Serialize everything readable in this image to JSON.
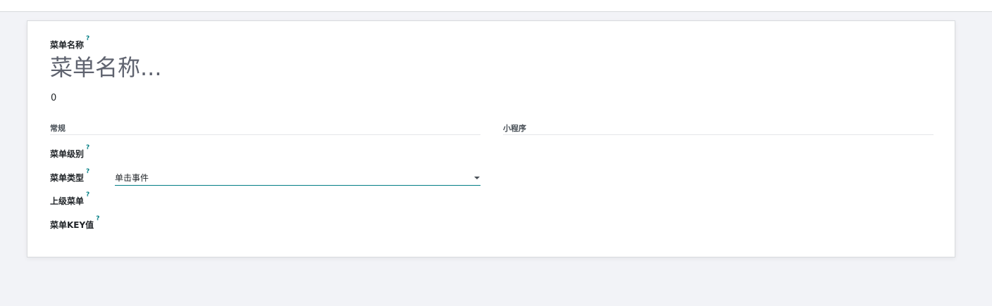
{
  "form": {
    "name_label": "菜单名称",
    "name_placeholder": "菜单名称...",
    "sequence_value": "0",
    "help_mark": "?"
  },
  "groups": {
    "general": "常规",
    "mini_program": "小程序"
  },
  "fields": {
    "level_label": "菜单级别",
    "type_label": "菜单类型",
    "type_value": "单击事件",
    "parent_label": "上级菜单",
    "key_label": "菜单KEY值"
  },
  "colors": {
    "accent": "#017e84",
    "background": "#f2f3f7"
  }
}
